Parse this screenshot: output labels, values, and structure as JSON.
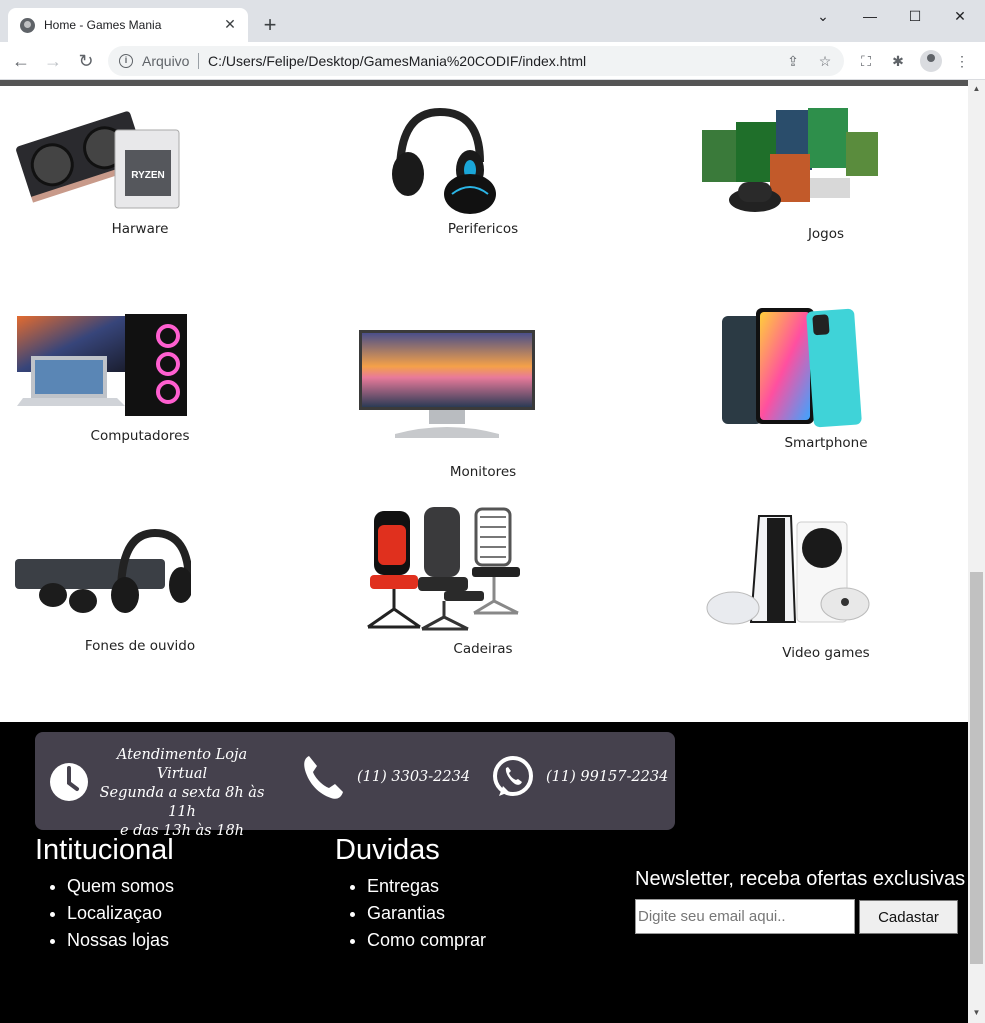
{
  "browser": {
    "tab_title": "Home - Games Mania",
    "address_scheme": "Arquivo",
    "address_url": "C:/Users/Felipe/Desktop/GamesMania%20CODIF/index.html"
  },
  "products": [
    {
      "label": "Harware"
    },
    {
      "label": "Perifericos"
    },
    {
      "label": "Jogos"
    },
    {
      "label": "Computadores"
    },
    {
      "label": "Monitores"
    },
    {
      "label": "Smartphone"
    },
    {
      "label": "Fones de ouvido"
    },
    {
      "label": "Cadeiras"
    },
    {
      "label": "Video games"
    }
  ],
  "footer": {
    "contact": {
      "hours_line1": "Atendimento Loja Virtual",
      "hours_line2": "Segunda a sexta 8h às 11h",
      "hours_line3": "e das 13h às 18h",
      "phone": "(11) 3303-2234",
      "whatsapp": "(11) 99157-2234"
    },
    "institutional": {
      "title": "Intitucional",
      "items": [
        "Quem somos",
        "Localizaçao",
        "Nossas lojas"
      ]
    },
    "doubts": {
      "title": "Duvidas",
      "items": [
        "Entregas",
        "Garantias",
        "Como comprar"
      ]
    },
    "newsletter": {
      "title": "Newsletter, receba ofertas exclusivas",
      "placeholder": "Digite seu email aqui..",
      "button": "Cadastar"
    }
  }
}
